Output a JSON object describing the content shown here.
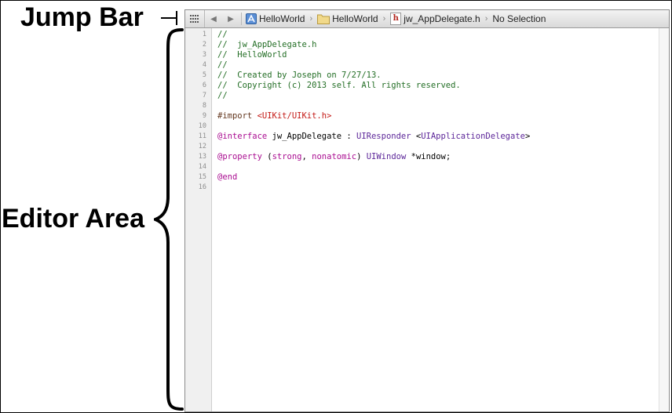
{
  "callouts": {
    "jump_bar": "Jump Bar",
    "editor_area": "Editor Area"
  },
  "jumpbar": {
    "crumbs": [
      {
        "label": "HelloWorld",
        "icon": "project-icon"
      },
      {
        "label": "HelloWorld",
        "icon": "folder-icon"
      },
      {
        "label": "jw_AppDelegate.h",
        "icon": "header-file-icon"
      },
      {
        "label": "No Selection",
        "icon": ""
      }
    ],
    "header_icon_glyph": "h"
  },
  "editor": {
    "line_numbers": [
      "1",
      "2",
      "3",
      "4",
      "5",
      "6",
      "7",
      "8",
      "9",
      "10",
      "11",
      "12",
      "13",
      "14",
      "15",
      "16"
    ],
    "lines": [
      {
        "tokens": [
          {
            "t": "//",
            "c": "comment"
          }
        ]
      },
      {
        "tokens": [
          {
            "t": "//  jw_AppDelegate.h",
            "c": "comment"
          }
        ]
      },
      {
        "tokens": [
          {
            "t": "//  HelloWorld",
            "c": "comment"
          }
        ]
      },
      {
        "tokens": [
          {
            "t": "//",
            "c": "comment"
          }
        ]
      },
      {
        "tokens": [
          {
            "t": "//  Created by Joseph on 7/27/13.",
            "c": "comment"
          }
        ]
      },
      {
        "tokens": [
          {
            "t": "//  Copyright (c) 2013 self. All rights reserved.",
            "c": "comment"
          }
        ]
      },
      {
        "tokens": [
          {
            "t": "//",
            "c": "comment"
          }
        ]
      },
      {
        "tokens": []
      },
      {
        "tokens": [
          {
            "t": "#import ",
            "c": "directive"
          },
          {
            "t": "<UIKit/UIKit.h>",
            "c": "string"
          }
        ]
      },
      {
        "tokens": []
      },
      {
        "tokens": [
          {
            "t": "@interface",
            "c": "keyword"
          },
          {
            "t": " jw_AppDelegate : ",
            "c": "plain"
          },
          {
            "t": "UIResponder",
            "c": "class"
          },
          {
            "t": " <",
            "c": "plain"
          },
          {
            "t": "UIApplicationDelegate",
            "c": "class"
          },
          {
            "t": ">",
            "c": "plain"
          }
        ]
      },
      {
        "tokens": []
      },
      {
        "tokens": [
          {
            "t": "@property",
            "c": "keyword"
          },
          {
            "t": " (",
            "c": "plain"
          },
          {
            "t": "strong",
            "c": "keyword"
          },
          {
            "t": ", ",
            "c": "plain"
          },
          {
            "t": "nonatomic",
            "c": "keyword"
          },
          {
            "t": ") ",
            "c": "plain"
          },
          {
            "t": "UIWindow",
            "c": "class"
          },
          {
            "t": " *window;",
            "c": "plain"
          }
        ]
      },
      {
        "tokens": []
      },
      {
        "tokens": [
          {
            "t": "@end",
            "c": "keyword"
          }
        ]
      },
      {
        "tokens": []
      }
    ]
  },
  "colors": {
    "comment": "#236e25",
    "keyword": "#aa0d91",
    "class": "#5c2699",
    "string": "#c41a16",
    "directive": "#643820"
  }
}
